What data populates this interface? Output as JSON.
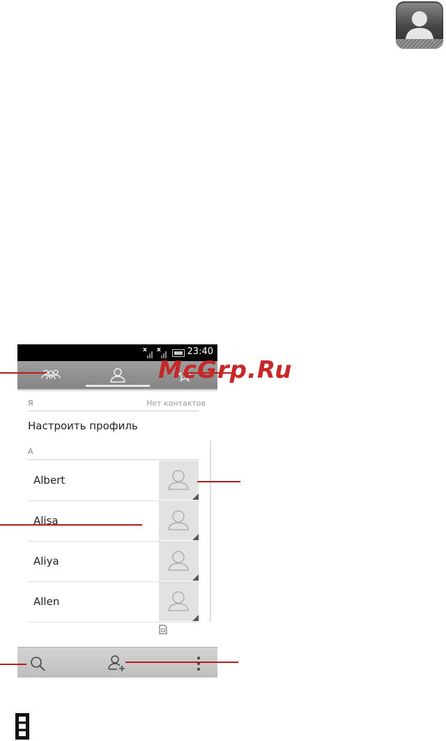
{
  "status_bar": {
    "time": "23:40"
  },
  "tabs": [
    {
      "name": "groups",
      "icon": "group-icon"
    },
    {
      "name": "contacts",
      "icon": "person-icon",
      "active": true
    },
    {
      "name": "favorites",
      "icon": "star-icon"
    }
  ],
  "profile_section": {
    "header": "Я",
    "empty_text": "Нет контактов",
    "setup_label": "Настроить профиль"
  },
  "letter_section": {
    "header": "А"
  },
  "contacts": [
    {
      "name": "Albert"
    },
    {
      "name": "Alisa"
    },
    {
      "name": "Aliya"
    },
    {
      "name": "Allen"
    }
  ],
  "bottom_bar": {
    "search_icon": "search-icon",
    "add_icon": "add-contact-icon",
    "menu_icon": "overflow-menu-icon"
  },
  "watermark": "McGrp.Ru",
  "colors": {
    "callout": "#b71c1c",
    "watermark": "#c62828",
    "tab_bar": "#8f8f8f"
  }
}
